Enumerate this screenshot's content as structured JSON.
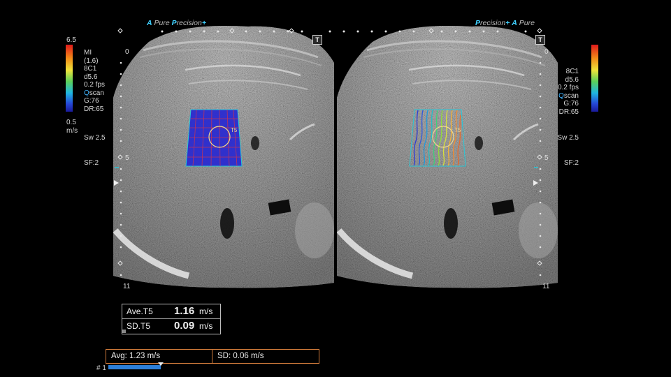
{
  "header": {
    "left_brand": {
      "p1": "A",
      "p2": "Pure",
      "p3": "P",
      "p4": "recision",
      "p5": "+"
    },
    "right_brand": {
      "p1": "P",
      "p2": "recision",
      "p3": "+",
      "p4": "A",
      "p5": "Pure"
    },
    "t_button": "T"
  },
  "scale": {
    "max": "6.5",
    "min": "0.5",
    "unit": "m/s"
  },
  "params": {
    "mi": "MI",
    "mi_val": "(1.6)",
    "probe": "8C1",
    "depth": "d5.6",
    "fps": "0.2 fps",
    "qscan_q": "Q",
    "qscan_rest": "scan",
    "gain": "G:76",
    "dr": "DR:65",
    "sw": "Sw 2.5",
    "sf": "SF:2"
  },
  "depth_marks": {
    "zero": "0",
    "five": "5",
    "eleven": "11"
  },
  "roi_label": "T5",
  "measurement": {
    "rows": [
      {
        "name": "Ave.T5",
        "value": "1.16",
        "unit": "m/s"
      },
      {
        "name": "SD.T5",
        "value": "0.09",
        "unit": "m/s"
      }
    ]
  },
  "stats": {
    "avg": "Avg:  1.23 m/s",
    "sd": "SD:  0.06 m/s"
  },
  "cine": {
    "label": "# 1",
    "progress": 1.0
  },
  "colors": {
    "accent": "#3fd0ff",
    "stats_border": "#d07a3a",
    "cine": "#2d7fd8"
  }
}
